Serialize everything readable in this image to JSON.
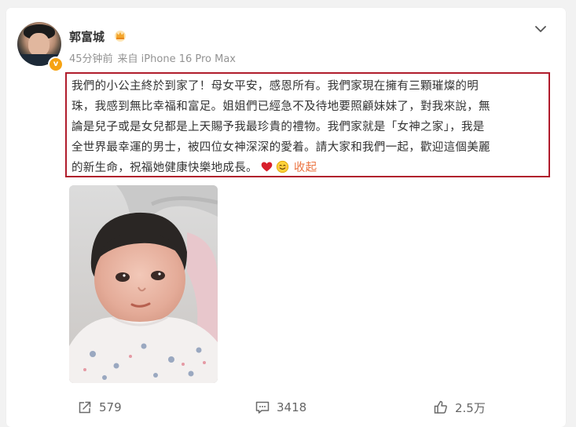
{
  "post": {
    "author": {
      "name": "郭富城",
      "avatar_icon": "avatar",
      "badge_icon": "crown-icon",
      "verified_icon": "verified-v-icon"
    },
    "timestamp": "45分钟前",
    "source": "来自 iPhone 16 Pro Max",
    "text_lines": [
      "我們的小公主終於到家了！母女平安，感恩所有。我們家現在擁有三顆璀燦的明",
      "珠，我感到無比幸福和富足。姐姐們已經急不及待地要照顧妹妹了，對我來說，無",
      "論是兒子或是女兒都是上天賜予我最珍貴的禮物。我們家就是「女神之家」，我是",
      "全世界最幸運的男士，被四位女神深深的愛着。請大家和我們一起，歡迎這個美麗",
      "的新生命，祝福她健康快樂地成長。"
    ],
    "emoji": [
      "heart-icon",
      "smile-icon"
    ],
    "collapse_label": "收起",
    "photo": "newborn-baby-photo"
  },
  "actions": {
    "share": {
      "icon": "share-icon",
      "count": "579"
    },
    "comment": {
      "icon": "comment-icon",
      "count": "3418"
    },
    "like": {
      "icon": "like-icon",
      "count": "2.5万"
    }
  },
  "colors": {
    "highlight_border": "#b01c2c",
    "link": "#eb7340",
    "verified": "#f6a313"
  }
}
